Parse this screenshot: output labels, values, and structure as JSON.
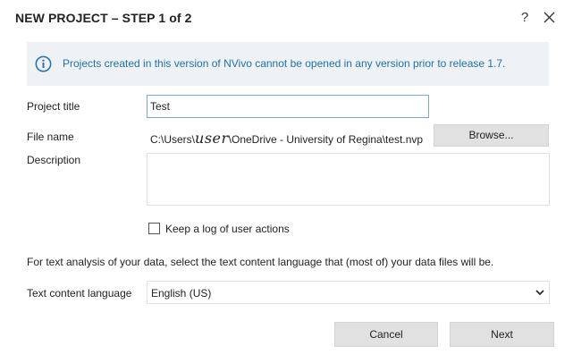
{
  "dialog": {
    "title": "NEW PROJECT – STEP 1 of 2",
    "help_label": "?"
  },
  "info": {
    "message": "Projects created in this version of NVivo cannot be opened in any version prior to release 1.7.",
    "icon": "info-circle-icon",
    "color": "#1f6fb2"
  },
  "form": {
    "project_title_label": "Project title",
    "project_title_value": "Test",
    "file_name_label": "File name",
    "file_name_prefix": "C:\\Users\\",
    "file_name_user": "user",
    "file_name_suffix": "\\OneDrive - University of Regina\\test.nvp",
    "browse_label": "Browse...",
    "description_label": "Description",
    "description_value": "",
    "log_checkbox_label": "Keep a log of user actions",
    "log_checkbox_checked": false,
    "language_instruction": "For text analysis of your data, select the text content language that (most of) your data files will be.",
    "language_label": "Text content language",
    "language_value": "English (US)"
  },
  "buttons": {
    "cancel_label": "Cancel",
    "next_label": "Next"
  }
}
